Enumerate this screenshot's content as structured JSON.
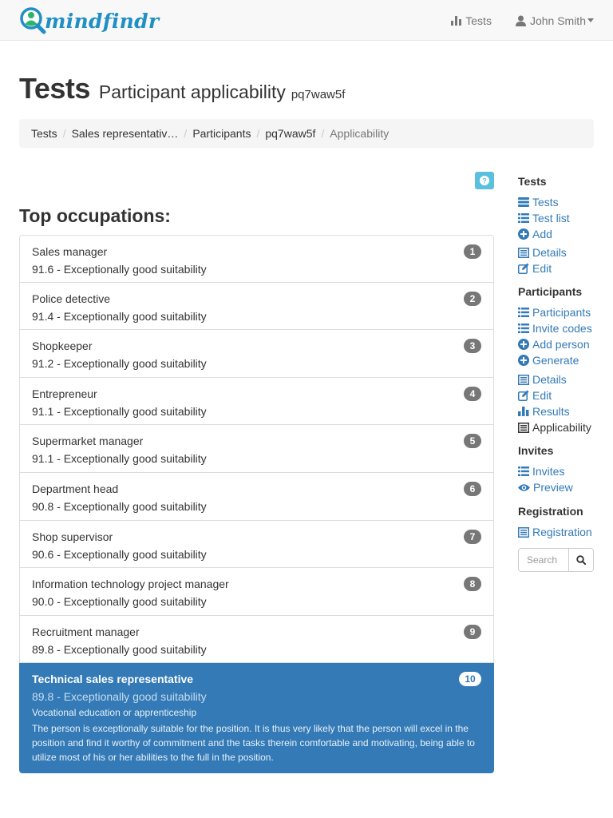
{
  "navbar": {
    "brand": "mindfindr",
    "tests_label": "Tests",
    "user_label": "John Smith"
  },
  "header": {
    "title": "Tests",
    "subtitle": "Participant applicability",
    "participant_id": "pq7waw5f"
  },
  "breadcrumb": [
    "Tests",
    "Sales representativ…",
    "Participants",
    "pq7waw5f",
    "Applicability"
  ],
  "section_title": "Top occupations:",
  "occupations": [
    {
      "rank": "1",
      "name": "Sales manager",
      "score": "91.6 - Exceptionally good suitability"
    },
    {
      "rank": "2",
      "name": "Police detective",
      "score": "91.4 - Exceptionally good suitability"
    },
    {
      "rank": "3",
      "name": "Shopkeeper",
      "score": "91.2 - Exceptionally good suitability"
    },
    {
      "rank": "4",
      "name": "Entrepreneur",
      "score": "91.1 - Exceptionally good suitability"
    },
    {
      "rank": "5",
      "name": "Supermarket manager",
      "score": "91.1 - Exceptionally good suitability"
    },
    {
      "rank": "6",
      "name": "Department head",
      "score": "90.8 - Exceptionally good suitability"
    },
    {
      "rank": "7",
      "name": "Shop supervisor",
      "score": "90.6 - Exceptionally good suitability"
    },
    {
      "rank": "8",
      "name": "Information technology project manager",
      "score": "90.0 - Exceptionally good suitability"
    },
    {
      "rank": "9",
      "name": "Recruitment manager",
      "score": "89.8 - Exceptionally good suitability"
    },
    {
      "rank": "10",
      "name": "Technical sales representative",
      "score": "89.8 - Exceptionally good suitability",
      "education": "Vocational education or apprenticeship",
      "description": "The person is exceptionally suitable for the position. It is thus very likely that the person will excel in the position and find it worthy of commitment and the tasks therein comfortable and motivating, being able to utilize most of his or her abilities to the full in the position."
    }
  ],
  "sidebar": {
    "tests": {
      "heading": "Tests",
      "items": [
        {
          "label": "Tests",
          "icon": "tasks-icon"
        },
        {
          "label": "Test list",
          "icon": "list-icon"
        },
        {
          "label": "Add",
          "icon": "plus-circle-icon"
        },
        {
          "label": "Details",
          "icon": "list-alt-icon"
        },
        {
          "label": "Edit",
          "icon": "edit-icon"
        }
      ]
    },
    "participants": {
      "heading": "Participants",
      "items": [
        {
          "label": "Participants",
          "icon": "list-icon"
        },
        {
          "label": "Invite codes",
          "icon": "list-icon"
        },
        {
          "label": "Add person",
          "icon": "plus-circle-icon"
        },
        {
          "label": "Generate",
          "icon": "plus-circle-icon"
        },
        {
          "label": "Details",
          "icon": "list-alt-icon"
        },
        {
          "label": "Edit",
          "icon": "edit-icon"
        },
        {
          "label": "Results",
          "icon": "stats-icon"
        },
        {
          "label": "Applicability",
          "icon": "list-alt-icon"
        }
      ]
    },
    "invites": {
      "heading": "Invites",
      "items": [
        {
          "label": "Invites",
          "icon": "list-icon"
        },
        {
          "label": "Preview",
          "icon": "eye-icon"
        }
      ]
    },
    "registration": {
      "heading": "Registration",
      "items": [
        {
          "label": "Registration",
          "icon": "list-alt-icon"
        }
      ]
    },
    "search_placeholder": "Search"
  },
  "colors": {
    "link": "#337ab7",
    "active_bg": "#337ab7",
    "help_button": "#5bc0de",
    "badge": "#777777"
  }
}
